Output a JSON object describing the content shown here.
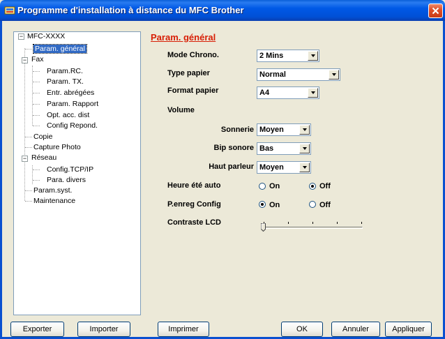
{
  "window": {
    "title": "Programme d'installation à distance du MFC Brother"
  },
  "tree": {
    "root": "MFC-XXXX",
    "items": [
      {
        "label": "Param. général",
        "selected": true
      },
      {
        "label": "Fax",
        "expanded": true
      },
      {
        "label": "Param.RC."
      },
      {
        "label": "Param. TX."
      },
      {
        "label": "Entr. abrégées"
      },
      {
        "label": "Param. Rapport"
      },
      {
        "label": "Opt. acc. dist"
      },
      {
        "label": "Config Repond."
      },
      {
        "label": "Copie"
      },
      {
        "label": "Capture Photo"
      },
      {
        "label": "Réseau",
        "expanded": true
      },
      {
        "label": "Config.TCP/IP"
      },
      {
        "label": "Para. divers"
      },
      {
        "label": "Param.syst."
      },
      {
        "label": "Maintenance"
      }
    ]
  },
  "panel": {
    "title": "Param. général",
    "mode_chrono": {
      "label": "Mode Chrono.",
      "value": "2 Mins"
    },
    "type_papier": {
      "label": "Type papier",
      "value": "Normal"
    },
    "format_papier": {
      "label": "Format papier",
      "value": "A4"
    },
    "volume": {
      "label": "Volume"
    },
    "sonnerie": {
      "label": "Sonnerie",
      "value": "Moyen"
    },
    "bip_sonore": {
      "label": "Bip sonore",
      "value": "Bas"
    },
    "haut_parleur": {
      "label": "Haut parleur",
      "value": "Moyen"
    },
    "heure_ete": {
      "label": "Heure été auto",
      "on": "On",
      "off": "Off",
      "selected": "Off"
    },
    "penreg": {
      "label": "P.enreg Config",
      "on": "On",
      "off": "Off",
      "selected": "On"
    },
    "contraste": {
      "label": "Contraste LCD",
      "level": 0
    }
  },
  "buttons": {
    "exporter": "Exporter",
    "importer": "Importer",
    "imprimer": "Imprimer",
    "ok": "OK",
    "annuler": "Annuler",
    "appliquer": "Appliquer"
  }
}
